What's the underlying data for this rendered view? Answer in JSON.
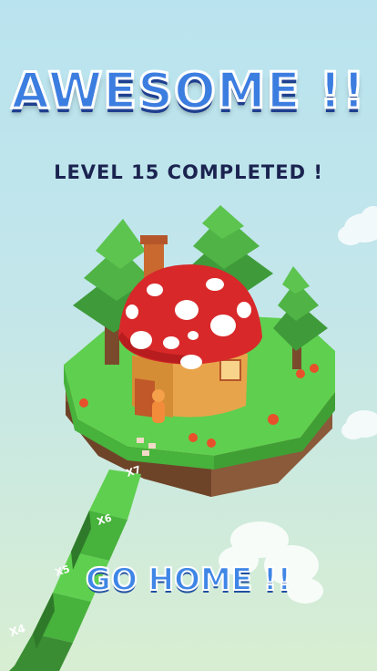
{
  "result": {
    "headline": "AWESOME !!",
    "status": "LEVEL 15 COMPLETED !"
  },
  "actions": {
    "home_label": "GO HOME !!"
  },
  "path": {
    "multipliers": [
      "X7",
      "X6",
      "X5",
      "X4"
    ]
  },
  "colors": {
    "headline": "#3c7de0",
    "headline_shadow": "#1f3f8f",
    "status_text": "#1b2350",
    "button_text": "#3f86e6",
    "grass": "#5fcf4f",
    "mushroom_cap": "#d8282a"
  }
}
